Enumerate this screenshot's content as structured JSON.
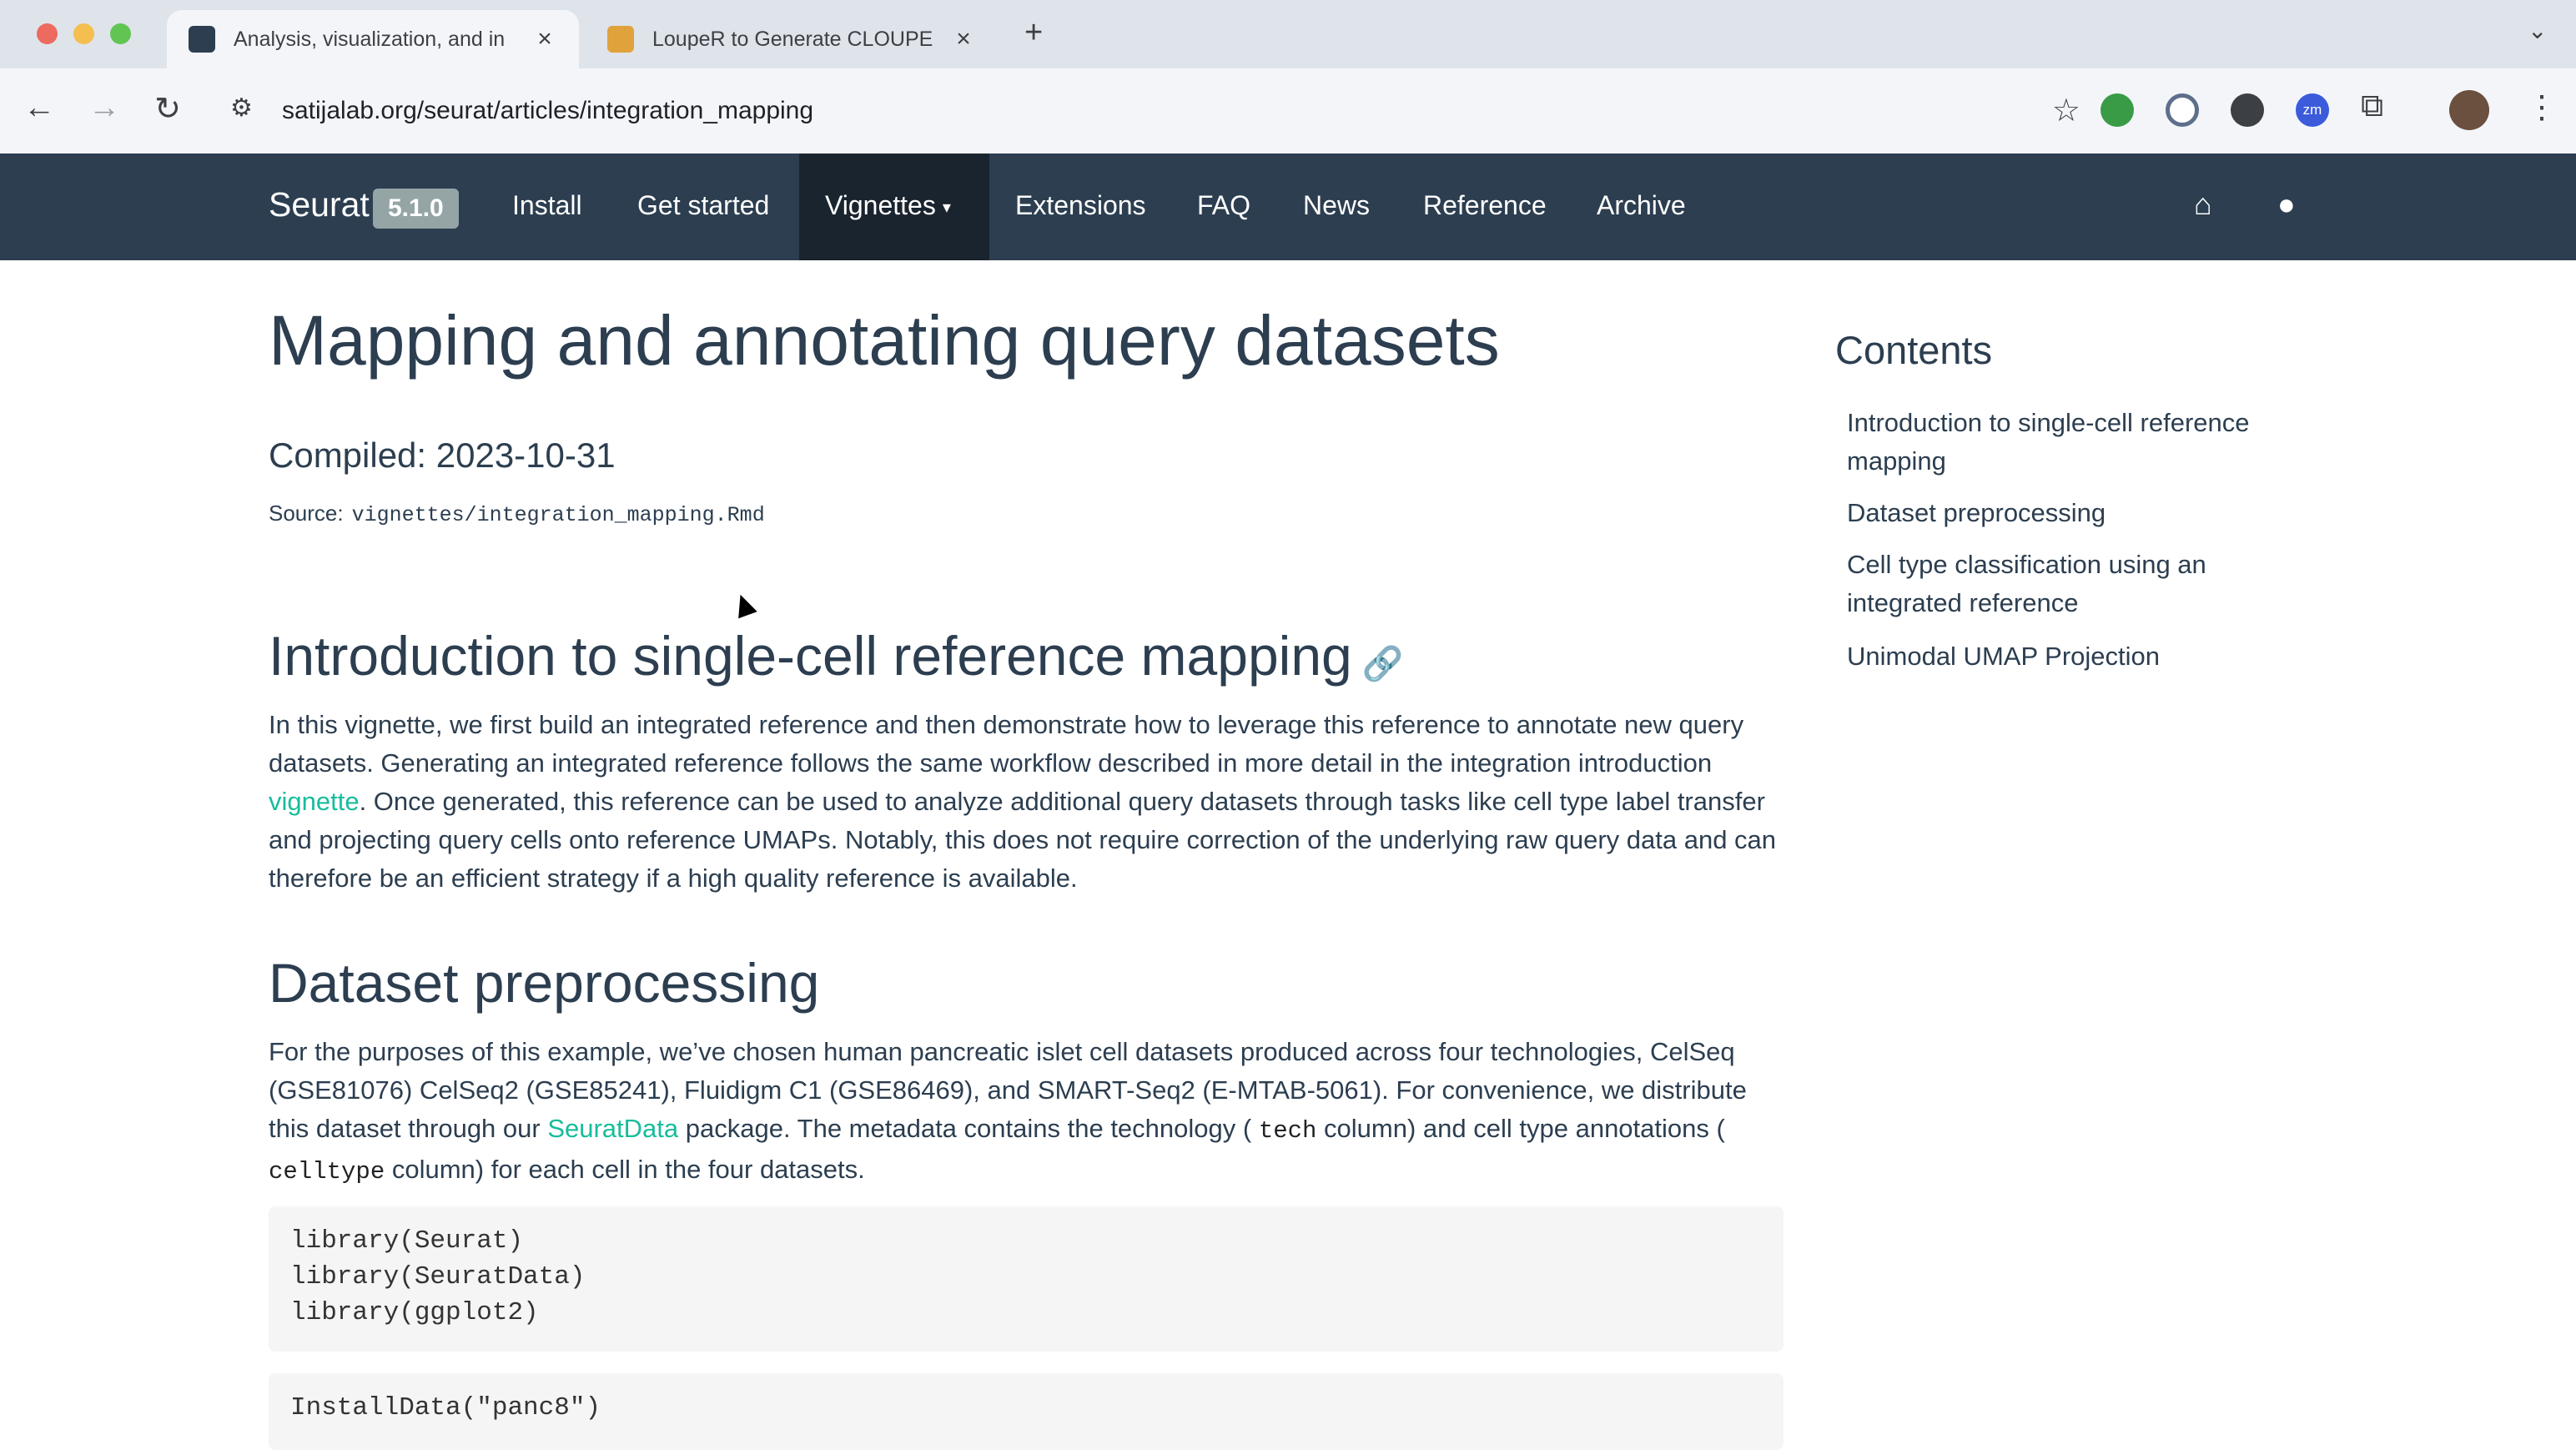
{
  "browser": {
    "tabs": [
      {
        "title": "Analysis, visualization, and in",
        "favicon_color": "#2c3e50"
      },
      {
        "title": "LoupeR to Generate CLOUPE",
        "favicon_color": "#e0a23b"
      }
    ],
    "new_tab_glyph": "+",
    "tabs_menu_glyph": "⌄",
    "close_glyph": "×",
    "url": "satijalab.org/seurat/articles/integration_mapping",
    "back_glyph": "←",
    "forward_glyph": "→",
    "reload_glyph": "↻",
    "site_settings_glyph": "⚙",
    "star_glyph": "☆",
    "extensions_glyph": "⧉",
    "menu_glyph": "⋮",
    "ext_zoom_label": "zm"
  },
  "navbar": {
    "brand": "Seurat",
    "version": "5.1.0",
    "links": [
      "Install",
      "Get started",
      "Vignettes",
      "Extensions",
      "FAQ",
      "News",
      "Reference",
      "Archive"
    ],
    "active": "Vignettes",
    "caret": "▾",
    "home_glyph": "⌂",
    "github_glyph": "●",
    "colors": {
      "bg": "#2c3e50",
      "active_bg": "#1a242f",
      "link": "#ffffff"
    }
  },
  "article": {
    "title": "Mapping and annotating query datasets",
    "compiled": "Compiled: 2023-10-31",
    "source_label": "Source:",
    "source_file": "vignettes/integration_mapping.Rmd",
    "anchor_glyph": "🔗",
    "sections": [
      {
        "heading": "Introduction to single-cell reference mapping",
        "para_before_link": "In this vignette, we first build an integrated reference and then demonstrate how to leverage this reference to annotate new query datasets. Generating an integrated reference follows the same workflow described in more detail in the integration introduction ",
        "link": "vignette",
        "para_after_link": ". Once generated, this reference can be used to analyze additional query datasets through tasks like cell type label transfer and projecting query cells onto reference UMAPs. Notably, this does not require correction of the underlying raw query data and can therefore be an efficient strategy if a high quality reference is available."
      },
      {
        "heading": "Dataset preprocessing",
        "p1": "For the purposes of this example, we’ve chosen human pancreatic islet cell datasets produced across four technologies, CelSeq (GSE81076) CelSeq2 (GSE85241), Fluidigm C1 (GSE86469), and SMART-Seq2 (E-MTAB-5061). For convenience, we distribute this dataset through our ",
        "link": "SeuratData",
        "p2": " package. The metadata contains the technology ( ",
        "code1": "tech",
        "p3": " column) and cell type annotations ( ",
        "code2": "celltype",
        "p4": " column) for each cell in the four datasets."
      }
    ],
    "code_block_1": [
      "library(Seurat)",
      "library(SeuratData)",
      "library(ggplot2)"
    ],
    "code_block_2": [
      "InstallData(\"panc8\")"
    ]
  },
  "toc": {
    "title": "Contents",
    "items": [
      "Introduction to single-cell reference mapping",
      "Dataset preprocessing",
      "Cell type classification using an integrated reference",
      "Unimodal UMAP Projection"
    ]
  },
  "colors": {
    "text": "#2c3e50",
    "link": "#18bc9c",
    "code_bg": "#f5f5f5"
  }
}
